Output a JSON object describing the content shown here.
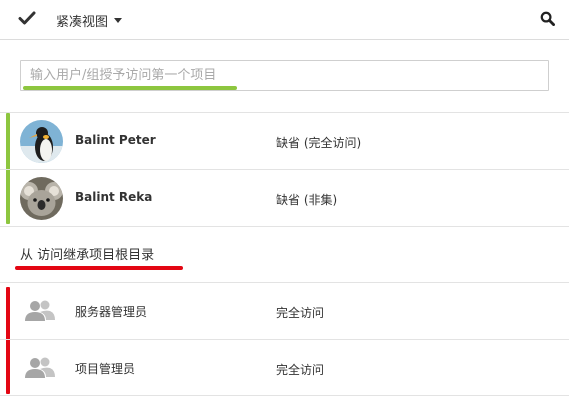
{
  "toolbar": {
    "check_icon": "check-icon",
    "view_label": "紧凑视图",
    "caret_icon": "caret-down-icon",
    "search_icon": "search-icon"
  },
  "search": {
    "placeholder": "输入用户/组授予访问第一个项目"
  },
  "direct_access": [
    {
      "name": "Balint Peter",
      "access": "缺省 (完全访问)",
      "avatar": "penguin-avatar"
    },
    {
      "name": "Balint Reka",
      "access": "缺省 (非集)",
      "avatar": "koala-avatar"
    }
  ],
  "inherited": {
    "heading": "从   访问继承项目根目录",
    "items": [
      {
        "name": "服务器管理员",
        "access": "完全访问",
        "icon": "group-icon"
      },
      {
        "name": "项目管理员",
        "access": "完全访问",
        "icon": "group-icon"
      }
    ]
  },
  "annotation_colors": {
    "green": "#8dc63f",
    "red": "#e30613"
  }
}
